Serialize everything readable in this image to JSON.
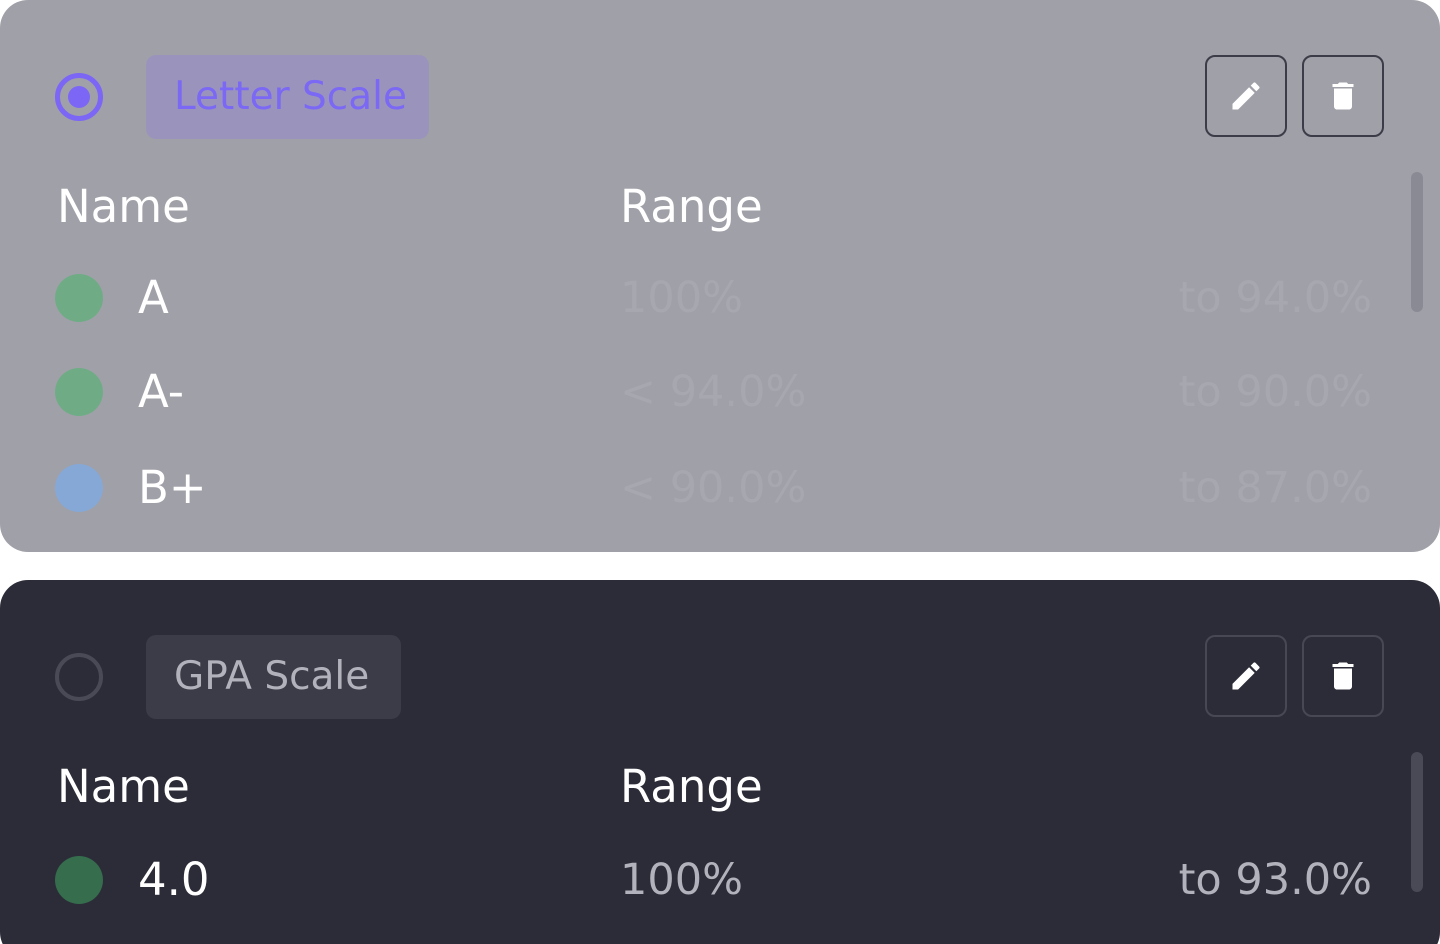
{
  "scales": [
    {
      "name": "Letter Scale",
      "selected": true,
      "columns": {
        "name": "Name",
        "range": "Range"
      },
      "rows": [
        {
          "name": "A",
          "color": "#6fac86",
          "from": "100%",
          "to": "to 94.0%"
        },
        {
          "name": "A-",
          "color": "#6fac86",
          "from": "< 94.0%",
          "to": "to 90.0%"
        },
        {
          "name": "B+",
          "color": "#86a8d6",
          "from": "< 90.0%",
          "to": "to 87.0%"
        }
      ]
    },
    {
      "name": "GPA Scale",
      "selected": false,
      "columns": {
        "name": "Name",
        "range": "Range"
      },
      "rows": [
        {
          "name": "4.0",
          "color": "#356d4d",
          "from": "100%",
          "to": "to 93.0%"
        }
      ]
    }
  ],
  "icons": {
    "edit": "pencil-icon",
    "delete": "trash-icon"
  },
  "colors": {
    "accent": "#7c66f6",
    "selected_card_bg": "#a0a0a8",
    "card_bg": "#2c2c38"
  }
}
